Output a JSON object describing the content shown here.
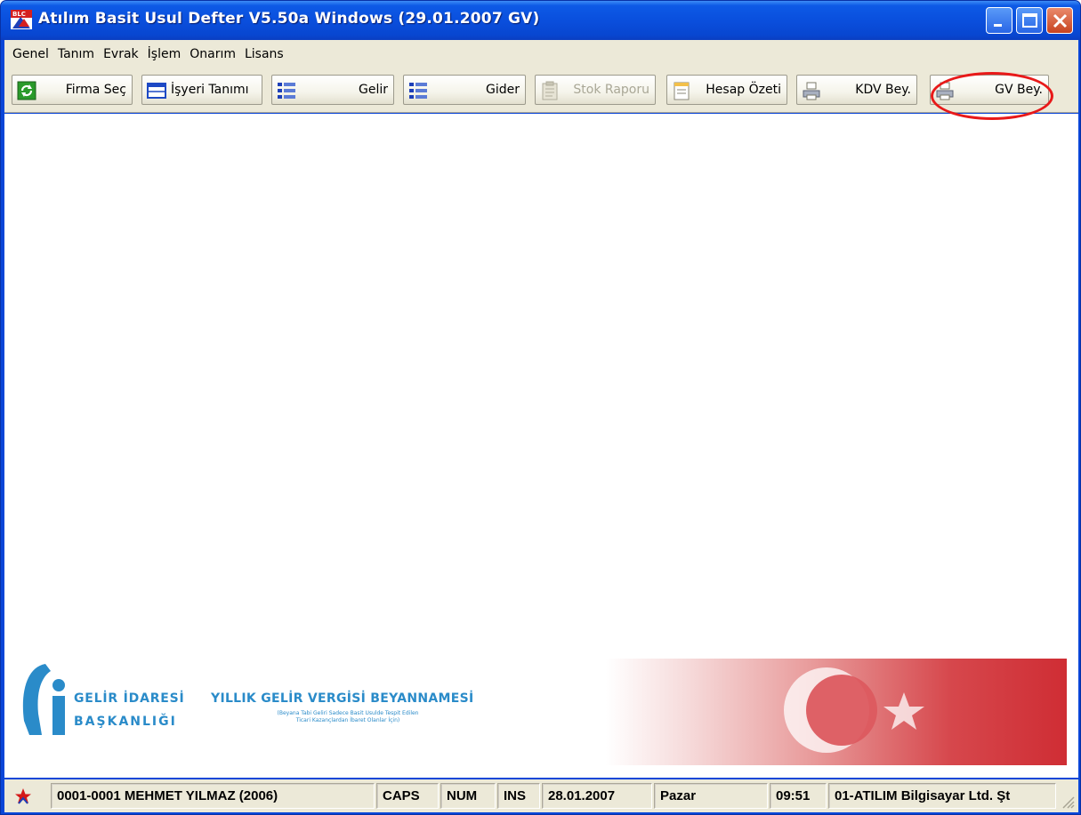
{
  "window": {
    "title": "Atılım Basit Usul Defter V5.50a Windows (29.01.2007 GV)"
  },
  "menu": [
    "Genel",
    "Tanım",
    "Evrak",
    "İşlem",
    "Onarım",
    "Lisans"
  ],
  "toolbar": {
    "firma_sec": "Firma Seç",
    "isyeri_tanimi": "İşyeri Tanımı",
    "gelir": "Gelir",
    "gider": "Gider",
    "stok_raporu": "Stok Raporu",
    "hesap_ozeti": "Hesap Özeti",
    "kdv_bey": "KDV Bey.",
    "gv_bey": "GV Bey."
  },
  "banner": {
    "org_line1": "GELİR İDARESİ",
    "org_line2": "BAŞKANLIĞI",
    "title": "YILLIK GELİR VERGİSİ BEYANNAMESİ",
    "subtitle_line1": "(Beyana Tabi Geliri Sadece Basit Usulde Tespit Edilen",
    "subtitle_line2": "Ticari Kazançlardan İbaret Olanlar İçin)"
  },
  "status": {
    "user": "0001-0001 MEHMET YILMAZ (2006)",
    "caps": "CAPS",
    "num": "NUM",
    "ins": "INS",
    "date": "28.01.2007",
    "day": "Pazar",
    "time": "09:51",
    "company": "01-ATILIM Bilgisayar Ltd. Şt"
  },
  "colors": {
    "title_bar": "#0a4fdd",
    "highlight": "#e81919",
    "gib_blue": "#2a8bc9",
    "flag_red": "#cf2d34"
  }
}
